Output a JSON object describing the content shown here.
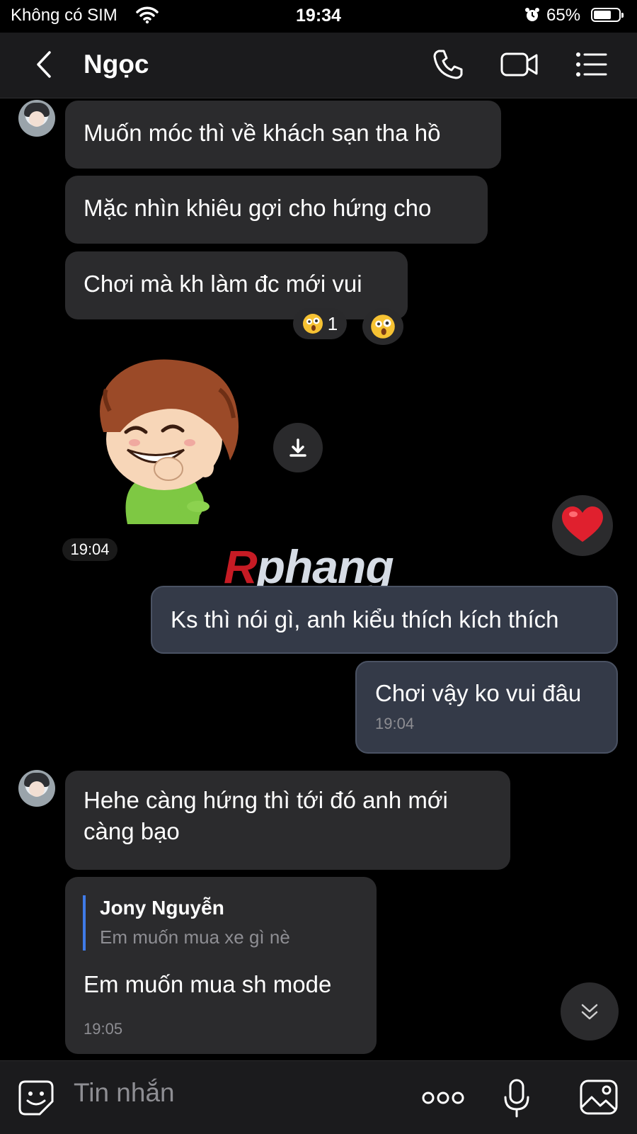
{
  "status_bar": {
    "carrier": "Không có SIM",
    "time": "19:34",
    "battery": "65%"
  },
  "header": {
    "title": "Ngọc"
  },
  "messages": [
    {
      "text": "Muốn móc thì về khách sạn tha hồ"
    },
    {
      "text": "Mặc nhìn khiêu gợi cho hứng cho"
    },
    {
      "text": "Chơi mà kh làm đc mới vui",
      "reaction_count": "1"
    }
  ],
  "sticker_time": "19:04",
  "watermark": {
    "first": "R",
    "rest": "phang"
  },
  "outgoing": [
    {
      "text": "Ks thì nói gì, anh kiểu thích kích thích"
    },
    {
      "text": "Chơi vậy ko vui đâu",
      "time": "19:04"
    }
  ],
  "incoming2": [
    {
      "text": "Hehe càng hứng thì tới đó anh mới càng bạo"
    },
    {
      "quote_name": "Jony Nguyễn",
      "quote_text": "Em muốn mua xe gì nè",
      "text": "Em muốn mua sh mode",
      "time": "19:05"
    }
  ],
  "input": {
    "placeholder": "Tin nhắn"
  },
  "colors": {
    "accent": "#3f7be8",
    "outgoing_bubble": "#343a48",
    "incoming_bubble": "#2b2b2d"
  },
  "icons": [
    "wifi-icon",
    "alarm-icon",
    "back-icon",
    "phone-icon",
    "video-icon",
    "menu-icon",
    "emoji-reaction-icon",
    "download-icon",
    "heart-icon",
    "scroll-down-icon",
    "sticker-icon",
    "more-icon",
    "mic-icon",
    "image-icon"
  ]
}
